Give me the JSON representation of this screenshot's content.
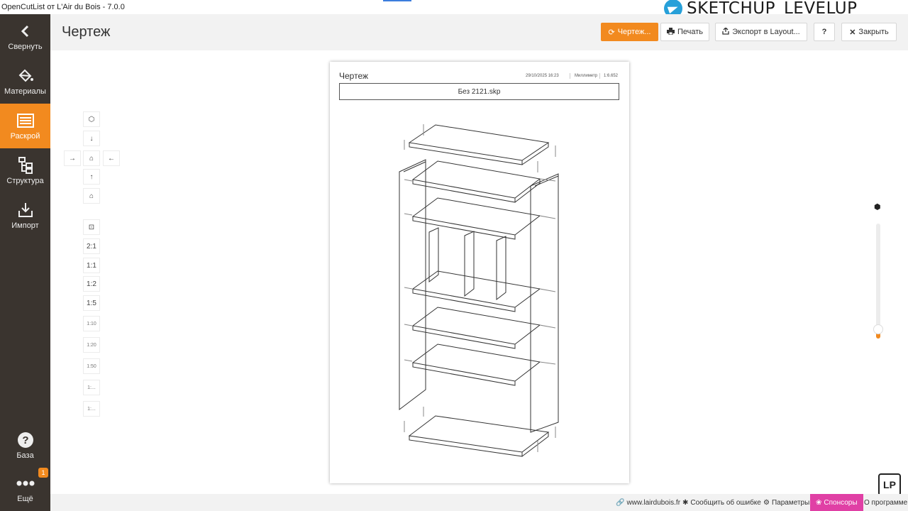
{
  "window": {
    "title": "OpenCutList от L'Air du Bois - 7.0.0"
  },
  "watermark": {
    "text": "SKETCHUP_LEVELUP",
    "icon": "telegram-icon"
  },
  "sidebar": {
    "items": [
      {
        "label": "Свернуть",
        "icon": "chevron-left-icon"
      },
      {
        "label": "Материалы",
        "icon": "paint-bucket-icon"
      },
      {
        "label": "Раскрой",
        "icon": "cutlist-icon"
      },
      {
        "label": "Структура",
        "icon": "tree-icon"
      },
      {
        "label": "Импорт",
        "icon": "import-icon"
      },
      {
        "label": "База",
        "icon": "help-circle-icon"
      },
      {
        "label": "Ещё",
        "icon": "more-icon",
        "badge": "1"
      }
    ]
  },
  "header": {
    "title": "Чертеж",
    "buttons": {
      "refresh": "Чертеж...",
      "print": "Печать",
      "export": "Экспорт в Layout...",
      "help": "?",
      "close": "Закрыть"
    }
  },
  "view_controls": {
    "scales": [
      "2:1",
      "1:1",
      "1:2",
      "1:5",
      "1:10",
      "1:20",
      "1:50",
      "1:...",
      "1:..."
    ]
  },
  "sheet": {
    "title": "Чертеж",
    "date": "29/10/2025 16:23",
    "unit": "Миллиметр",
    "scale": "1:6.652",
    "filename": "Без 2121.skp"
  },
  "zoom_slider": {
    "value": 0.08
  },
  "footer": {
    "website": "www.lairdubois.fr",
    "report": "Сообщить об ошибке",
    "settings": "Параметры",
    "sponsors": "Спонсоры",
    "about": "О программе"
  },
  "logo": {
    "text": "LP"
  },
  "colors": {
    "accent": "#f28a1f",
    "sidebar": "#3a342f",
    "sponsor": "#e040a5"
  }
}
